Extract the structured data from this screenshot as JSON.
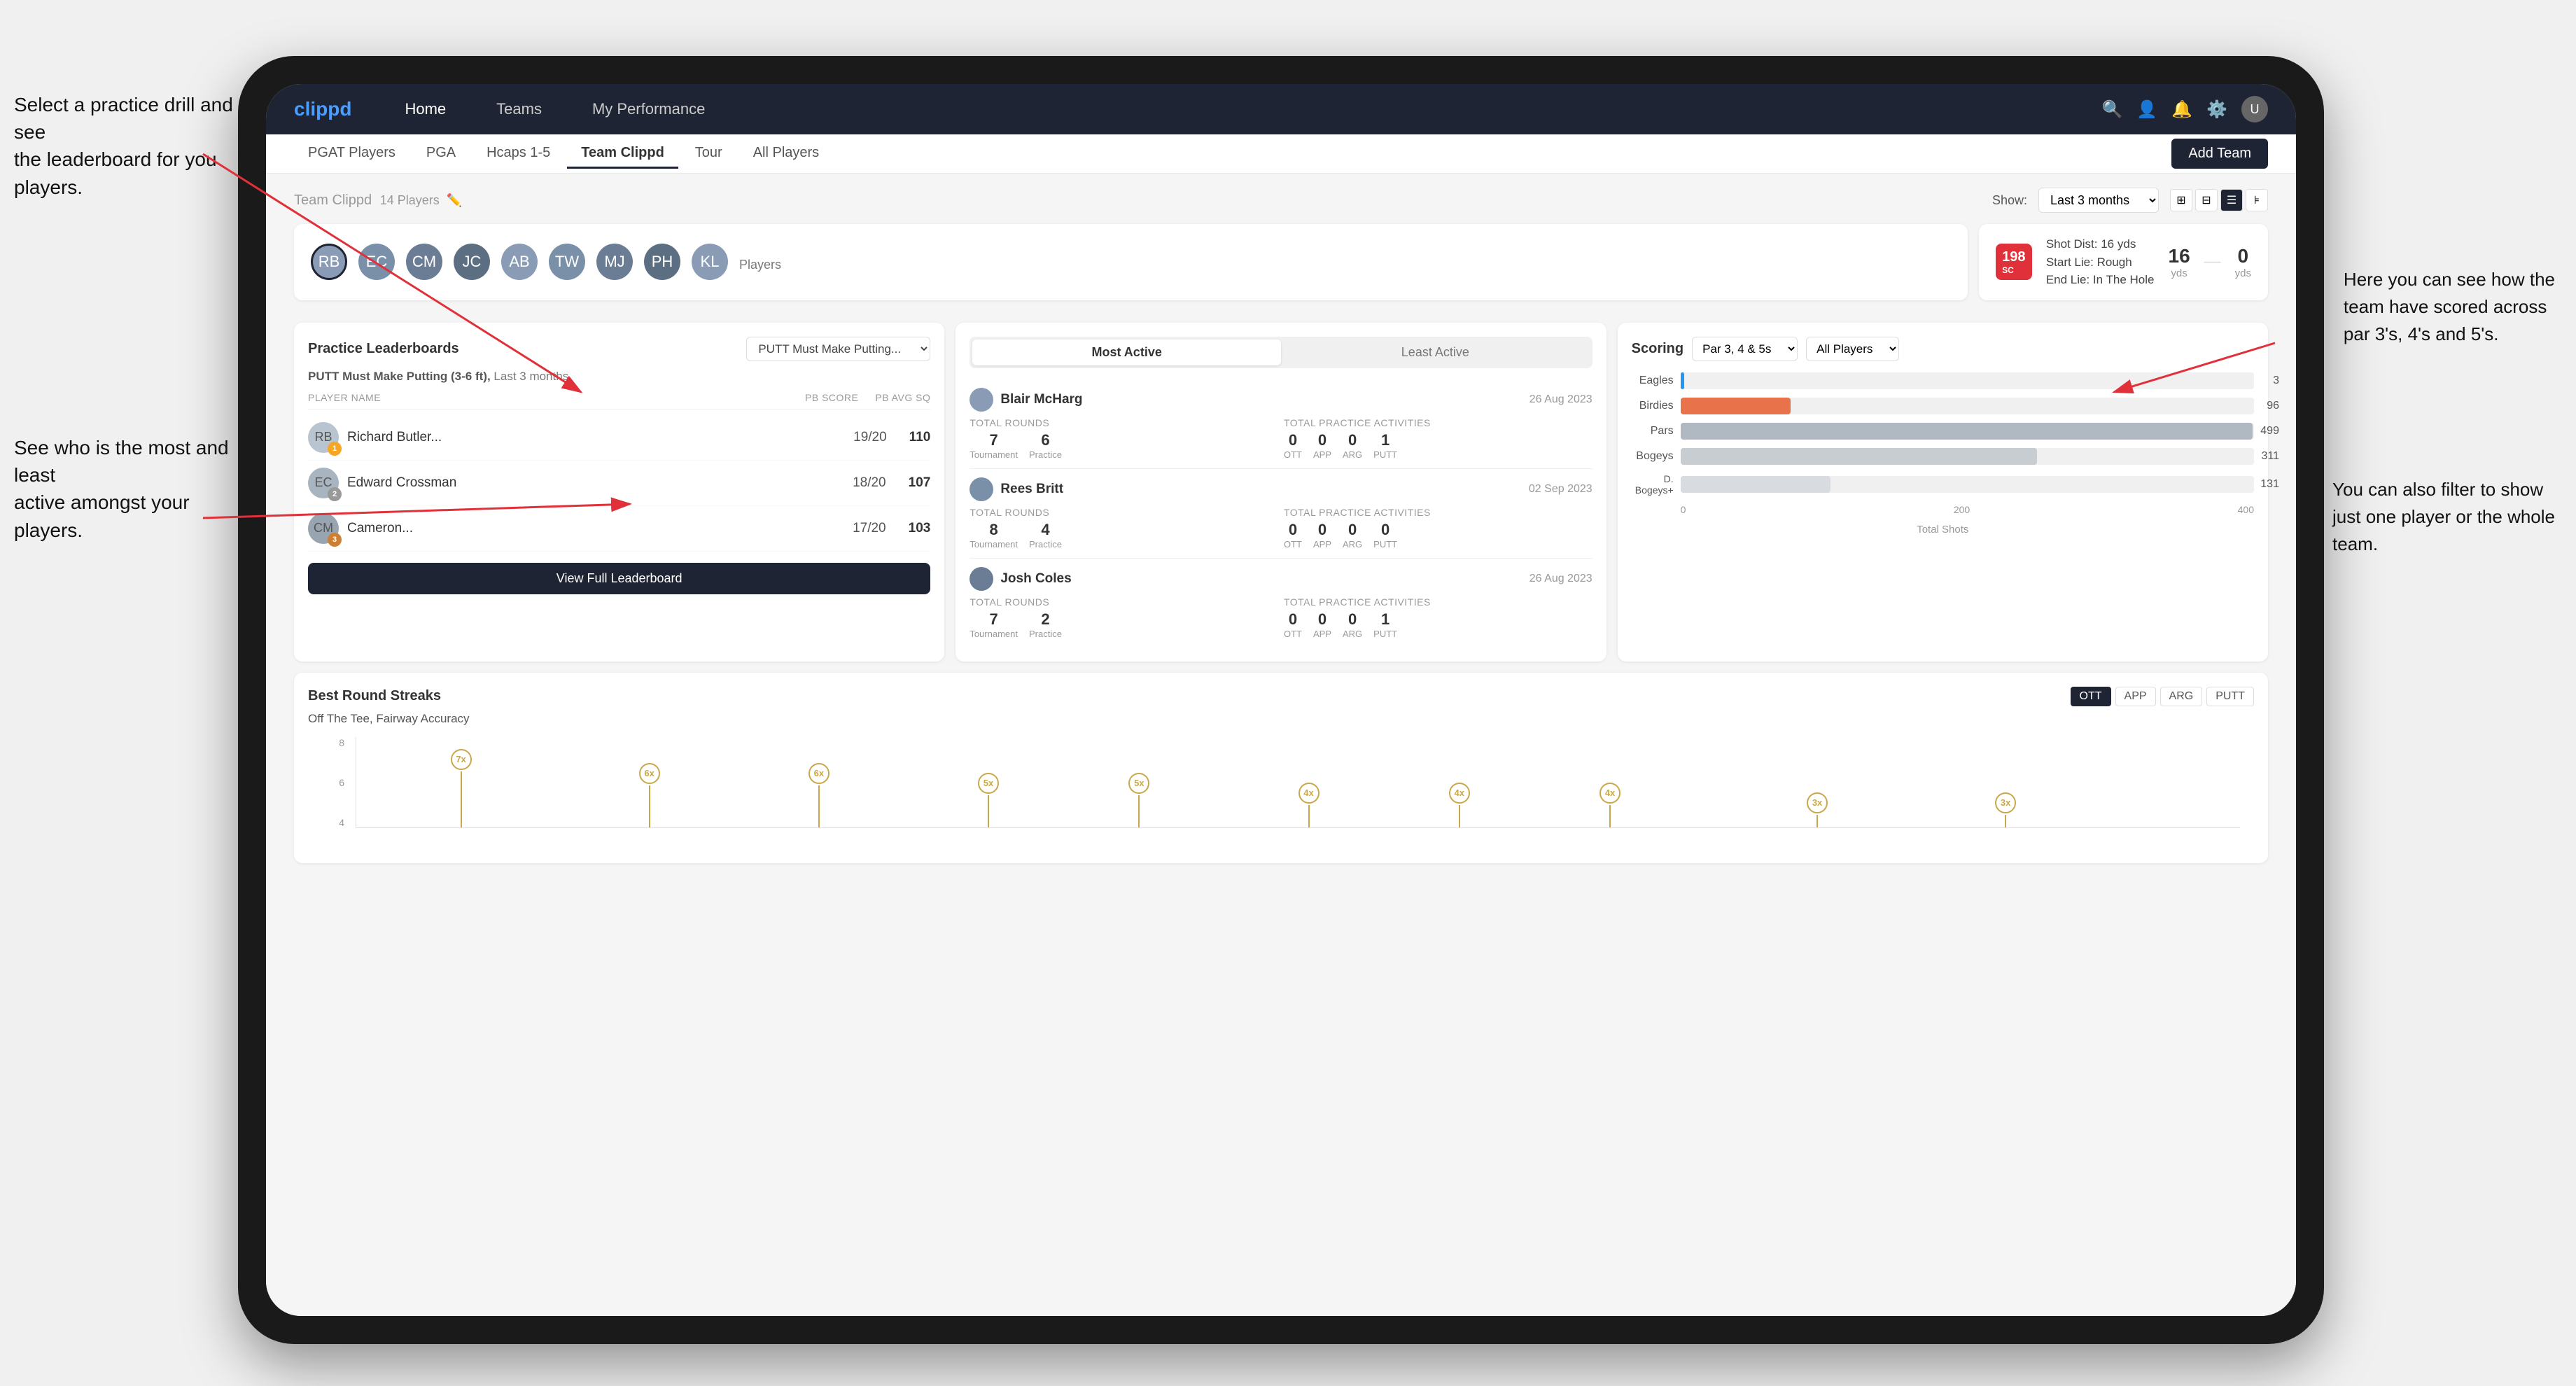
{
  "annotations": {
    "left_top": "Select a practice drill and see\nthe leaderboard for you players.",
    "left_bottom": "See who is the most and least\nactive amongst your players.",
    "right_top": "Here you can see how the\nteam have scored across\npar 3's, 4's and 5's.",
    "right_bottom": "You can also filter to show\njust one player or the whole\nteam."
  },
  "nav": {
    "logo": "clippd",
    "items": [
      "Home",
      "Teams",
      "My Performance"
    ],
    "icons": [
      "🔍",
      "👤",
      "🔔",
      "⚙️"
    ],
    "active": "Teams"
  },
  "sub_nav": {
    "items": [
      "PGAT Players",
      "PGA",
      "Hcaps 1-5",
      "Team Clippd",
      "Tour",
      "All Players"
    ],
    "active": "Team Clippd",
    "add_button": "Add Team"
  },
  "team_header": {
    "title": "Team Clippd",
    "player_count": "14 Players",
    "show_label": "Show:",
    "show_value": "Last 3 months",
    "views": [
      "grid-small",
      "grid-large",
      "list",
      "filter"
    ]
  },
  "players": [
    {
      "id": 1,
      "initials": "RB",
      "color": "#8a9bb5"
    },
    {
      "id": 2,
      "initials": "EC",
      "color": "#7a8fa8"
    },
    {
      "id": 3,
      "initials": "CM",
      "color": "#6b7d94"
    },
    {
      "id": 4,
      "initials": "JC",
      "color": "#5c6e82"
    },
    {
      "id": 5,
      "initials": "AB",
      "color": "#8a9bb5"
    },
    {
      "id": 6,
      "initials": "TW",
      "color": "#7a8fa8"
    },
    {
      "id": 7,
      "initials": "MJ",
      "color": "#6b7d94"
    },
    {
      "id": 8,
      "initials": "PH",
      "color": "#5c6e82"
    },
    {
      "id": 9,
      "initials": "KL",
      "color": "#8a9bb5"
    }
  ],
  "shot_info": {
    "badge": "198",
    "badge_sub": "SC",
    "line1": "Shot Dist: 16 yds",
    "line2": "Start Lie: Rough",
    "line3": "End Lie: In The Hole",
    "val1": "16",
    "lbl1": "yds",
    "val2": "0",
    "lbl2": "yds"
  },
  "practice_leaderboard": {
    "title": "Practice Leaderboards",
    "filter": "PUTT Must Make Putting...",
    "subtitle": "PUTT Must Make Putting (3-6 ft),",
    "time_range": "Last 3 months",
    "columns": [
      "PLAYER NAME",
      "PB SCORE",
      "PB AVG SQ"
    ],
    "players": [
      {
        "name": "Richard Butler...",
        "score": "19/20",
        "avg": "110",
        "rank": 1,
        "medal": "gold"
      },
      {
        "name": "Edward Crossman",
        "score": "18/20",
        "avg": "107",
        "rank": 2,
        "medal": "silver"
      },
      {
        "name": "Cameron...",
        "score": "17/20",
        "avg": "103",
        "rank": 3,
        "medal": "bronze"
      }
    ],
    "view_full_btn": "View Full Leaderboard"
  },
  "activity": {
    "tabs": [
      "Most Active",
      "Least Active"
    ],
    "active_tab": "Most Active",
    "players": [
      {
        "name": "Blair McHarg",
        "date": "26 Aug 2023",
        "total_rounds_label": "Total Rounds",
        "tournament": "7",
        "practice": "6",
        "practice_activities_label": "Total Practice Activities",
        "ott": "0",
        "app": "0",
        "arg": "0",
        "putt": "1"
      },
      {
        "name": "Rees Britt",
        "date": "02 Sep 2023",
        "total_rounds_label": "Total Rounds",
        "tournament": "8",
        "practice": "4",
        "practice_activities_label": "Total Practice Activities",
        "ott": "0",
        "app": "0",
        "arg": "0",
        "putt": "0"
      },
      {
        "name": "Josh Coles",
        "date": "26 Aug 2023",
        "total_rounds_label": "Total Rounds",
        "tournament": "7",
        "practice": "2",
        "practice_activities_label": "Total Practice Activities",
        "ott": "0",
        "app": "0",
        "arg": "0",
        "putt": "1"
      }
    ]
  },
  "scoring": {
    "title": "Scoring",
    "filter1": "Par 3, 4 & 5s",
    "filter2": "All Players",
    "bars": [
      {
        "label": "Eagles",
        "value": 3,
        "max": 500,
        "color": "#2196F3",
        "display": "3"
      },
      {
        "label": "Birdies",
        "value": 96,
        "max": 500,
        "color": "#e8734a",
        "display": "96"
      },
      {
        "label": "Pars",
        "value": 499,
        "max": 500,
        "color": "#b0b8c1",
        "display": "499"
      },
      {
        "label": "Bogeys",
        "value": 311,
        "max": 500,
        "color": "#c8cdd2",
        "display": "311"
      },
      {
        "label": "D. Bogeys+",
        "value": 131,
        "max": 500,
        "color": "#d8dce0",
        "display": "131"
      }
    ],
    "x_labels": [
      "0",
      "200",
      "400"
    ],
    "footer": "Total Shots"
  },
  "streaks": {
    "title": "Best Round Streaks",
    "btns": [
      "OTT",
      "APP",
      "ARG",
      "PUTT"
    ],
    "active_btn": "OTT",
    "subtitle": "Off The Tee, Fairway Accuracy",
    "dots": [
      {
        "label": "7x",
        "x": 8
      },
      {
        "label": "6x",
        "x": 18
      },
      {
        "label": "6x",
        "x": 28
      },
      {
        "label": "5x",
        "x": 38
      },
      {
        "label": "5x",
        "x": 48
      },
      {
        "label": "4x",
        "x": 58
      },
      {
        "label": "4x",
        "x": 66
      },
      {
        "label": "4x",
        "x": 74
      },
      {
        "label": "3x",
        "x": 84
      },
      {
        "label": "3x",
        "x": 92
      }
    ]
  }
}
